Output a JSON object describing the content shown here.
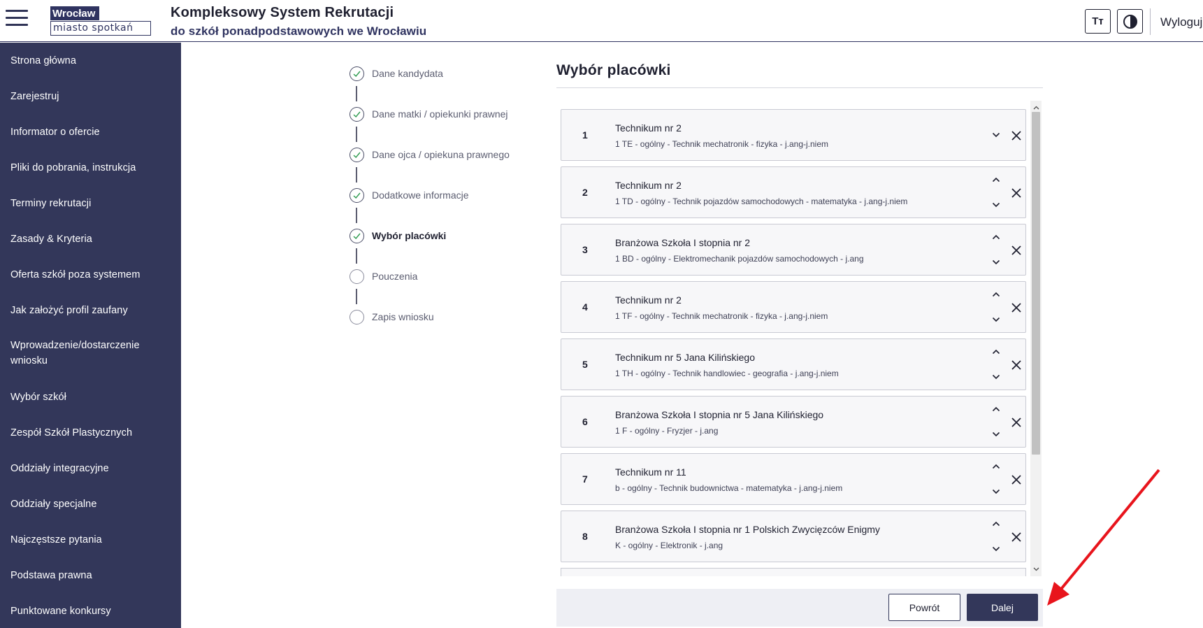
{
  "header": {
    "logo_top": "Wrocław",
    "logo_bottom": "miasto spotkań",
    "title": "Kompleksowy System Rekrutacji",
    "subtitle": "do szkół ponadpodstawowych we Wrocławiu",
    "font_button_label": "Tт",
    "logout_label": "Wyloguj"
  },
  "sidebar": {
    "items": [
      {
        "label": "Strona główna"
      },
      {
        "label": "Zarejestruj"
      },
      {
        "label": "Informator o ofercie"
      },
      {
        "label": "Pliki do pobrania, instrukcja"
      },
      {
        "label": "Terminy rekrutacji"
      },
      {
        "label": "Zasady & Kryteria"
      },
      {
        "label": "Oferta szkół poza systemem"
      },
      {
        "label": "Jak założyć profil zaufany"
      },
      {
        "label": "Wprowadzenie/dostarczenie wniosku"
      },
      {
        "label": "Wybór szkół"
      },
      {
        "label": "Zespół Szkół Plastycznych"
      },
      {
        "label": "Oddziały integracyjne"
      },
      {
        "label": "Oddziały specjalne"
      },
      {
        "label": "Najczęstsze pytania"
      },
      {
        "label": "Podstawa prawna"
      },
      {
        "label": "Punktowane konkursy"
      }
    ]
  },
  "stepper": {
    "steps": [
      {
        "label": "Dane kandydata",
        "state": "done"
      },
      {
        "label": "Dane matki / opiekunki prawnej",
        "state": "done"
      },
      {
        "label": "Dane ojca / opiekuna prawnego",
        "state": "done"
      },
      {
        "label": "Dodatkowe informacje",
        "state": "done"
      },
      {
        "label": "Wybór placówki",
        "state": "current"
      },
      {
        "label": "Pouczenia",
        "state": "todo"
      },
      {
        "label": "Zapis wniosku",
        "state": "todo"
      }
    ]
  },
  "main": {
    "section_title": "Wybór placówki",
    "schools": [
      {
        "number": "1",
        "name": "Technikum nr 2",
        "details": "1 TE - ogólny - Technik mechatronik - fizyka - j.ang-j.niem"
      },
      {
        "number": "2",
        "name": "Technikum nr 2",
        "details": "1 TD - ogólny - Technik pojazdów samochodowych - matematyka - j.ang-j.niem"
      },
      {
        "number": "3",
        "name": "Branżowa Szkoła I stopnia nr 2",
        "details": "1 BD - ogólny - Elektromechanik pojazdów samochodowych - j.ang"
      },
      {
        "number": "4",
        "name": "Technikum nr 2",
        "details": "1 TF - ogólny - Technik mechatronik - fizyka - j.ang-j.niem"
      },
      {
        "number": "5",
        "name": "Technikum nr 5 Jana Kilińskiego",
        "details": "1 TH - ogólny - Technik handlowiec - geografia - j.ang-j.niem"
      },
      {
        "number": "6",
        "name": "Branżowa Szkoła I stopnia nr 5 Jana Kilińskiego",
        "details": "1 F - ogólny - Fryzjer - j.ang"
      },
      {
        "number": "7",
        "name": "Technikum nr 11",
        "details": "b - ogólny - Technik budownictwa - matematyka - j.ang-j.niem"
      },
      {
        "number": "8",
        "name": "Branżowa Szkoła I stopnia nr 1 Polskich Zwycięzców Enigmy",
        "details": "K - ogólny - Elektronik - j.ang"
      }
    ]
  },
  "footer": {
    "back_label": "Powrót",
    "next_label": "Dalej"
  },
  "icons": {
    "menu": "hamburger-icon",
    "contrast": "contrast-icon",
    "step_done": "check-circle-icon",
    "move_up": "chevron-up-icon",
    "move_down": "chevron-down-icon",
    "remove": "close-icon",
    "annotation": "red-arrow-annotation"
  },
  "colors": {
    "sidebar_bg": "#33375a",
    "primary": "#33375a",
    "annotation_arrow": "#e8141c"
  }
}
